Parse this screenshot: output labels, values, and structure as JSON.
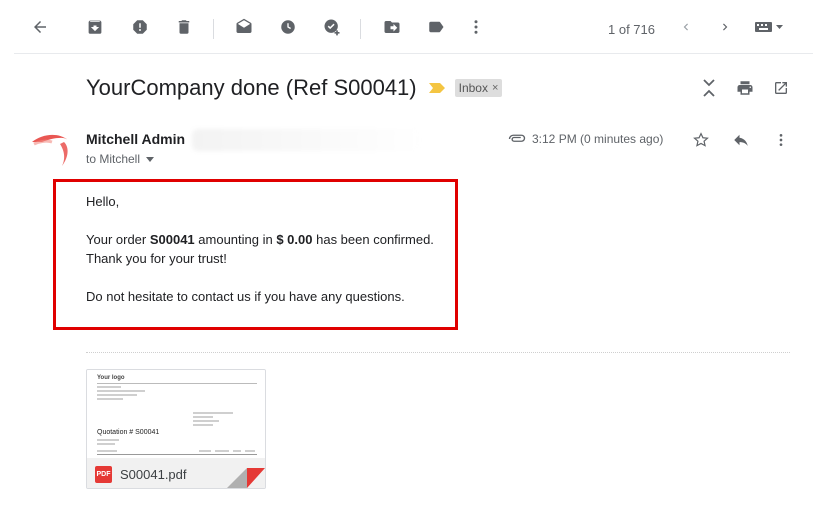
{
  "toolbar": {
    "back": "back-icon",
    "actions": [
      "archive-icon",
      "report-spam-icon",
      "delete-icon",
      "mark-unread-icon",
      "snooze-icon",
      "add-to-tasks-icon",
      "move-to-icon",
      "labels-icon",
      "more-icon"
    ],
    "pager": "1 of 716"
  },
  "message": {
    "subject": "YourCompany done (Ref S00041)",
    "label_chip": "Inbox",
    "label_chip_close": "×",
    "sender_name": "Mitchell Admin",
    "recipient": "to Mitchell",
    "time": "3:12 PM (0 minutes ago)",
    "body": {
      "greeting": "Hello,",
      "line1_prefix": "Your order ",
      "order_ref": "S00041",
      "line1_middle": " amounting in ",
      "amount": "$ 0.00",
      "line1_suffix": " has been confirmed.",
      "line2": "Thank you for your trust!",
      "line3": "Do not hesitate to contact us if you have any questions."
    },
    "attachment": {
      "filename": "S00041.pdf",
      "badge": "PDF",
      "preview_title": "Your logo",
      "preview_heading": "Quotation # S00041"
    }
  },
  "colors": {
    "highlight_border": "#e00000",
    "important_marker": "#f4c542",
    "pdf_red": "#e53935"
  }
}
